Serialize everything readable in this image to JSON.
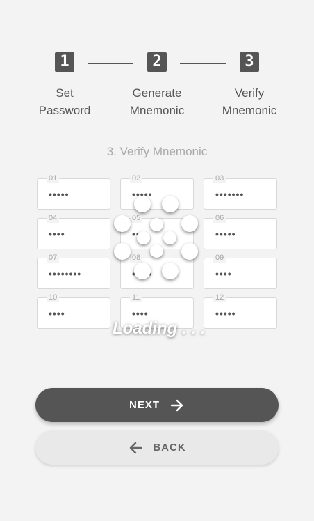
{
  "steps": [
    {
      "number": "1",
      "label_line1": "Set",
      "label_line2": "Password"
    },
    {
      "number": "2",
      "label_line1": "Generate",
      "label_line2": "Mnemonic"
    },
    {
      "number": "3",
      "label_line1": "Verify",
      "label_line2": "Mnemonic"
    }
  ],
  "section_title": "3. Verify Mnemonic",
  "fields": [
    {
      "label": "01",
      "value": "•••••"
    },
    {
      "label": "02",
      "value": "•••••"
    },
    {
      "label": "03",
      "value": "•••••••"
    },
    {
      "label": "04",
      "value": "••••"
    },
    {
      "label": "05",
      "value": "••••"
    },
    {
      "label": "06",
      "value": "•••••"
    },
    {
      "label": "07",
      "value": "••••••••"
    },
    {
      "label": "08",
      "value": "•••••"
    },
    {
      "label": "09",
      "value": "••••"
    },
    {
      "label": "10",
      "value": "••••"
    },
    {
      "label": "11",
      "value": "••••"
    },
    {
      "label": "12",
      "value": "•••••"
    }
  ],
  "loading_text": "Loading . . .",
  "buttons": {
    "next_label": "NEXT",
    "back_label": "BACK"
  },
  "icons": {
    "next": "arrow-right-icon",
    "back": "arrow-left-icon"
  }
}
